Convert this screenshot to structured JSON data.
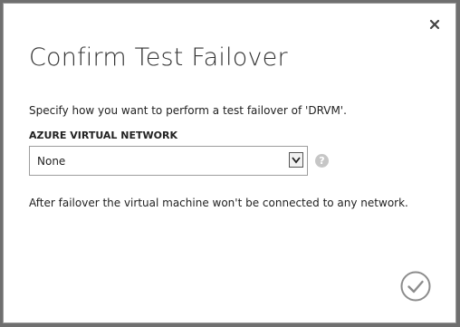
{
  "dialog": {
    "title": "Confirm Test Failover",
    "description": "Specify how you want to perform a test failover of 'DRVM'.",
    "network_label": "AZURE VIRTUAL NETWORK",
    "network_select": {
      "selected": "None"
    },
    "help_glyph": "?",
    "note": "After failover the virtual machine won't be connected to any network."
  },
  "icons": {
    "close": "close-icon",
    "dropdown": "chevron-down-icon",
    "help": "help-icon",
    "confirm": "checkmark-circle-icon"
  },
  "colors": {
    "backdrop": "#6f6f6f",
    "dialog_background": "#ffffff",
    "help_icon": "#c6c6c6",
    "confirm_icon": "#8c8c8c"
  }
}
